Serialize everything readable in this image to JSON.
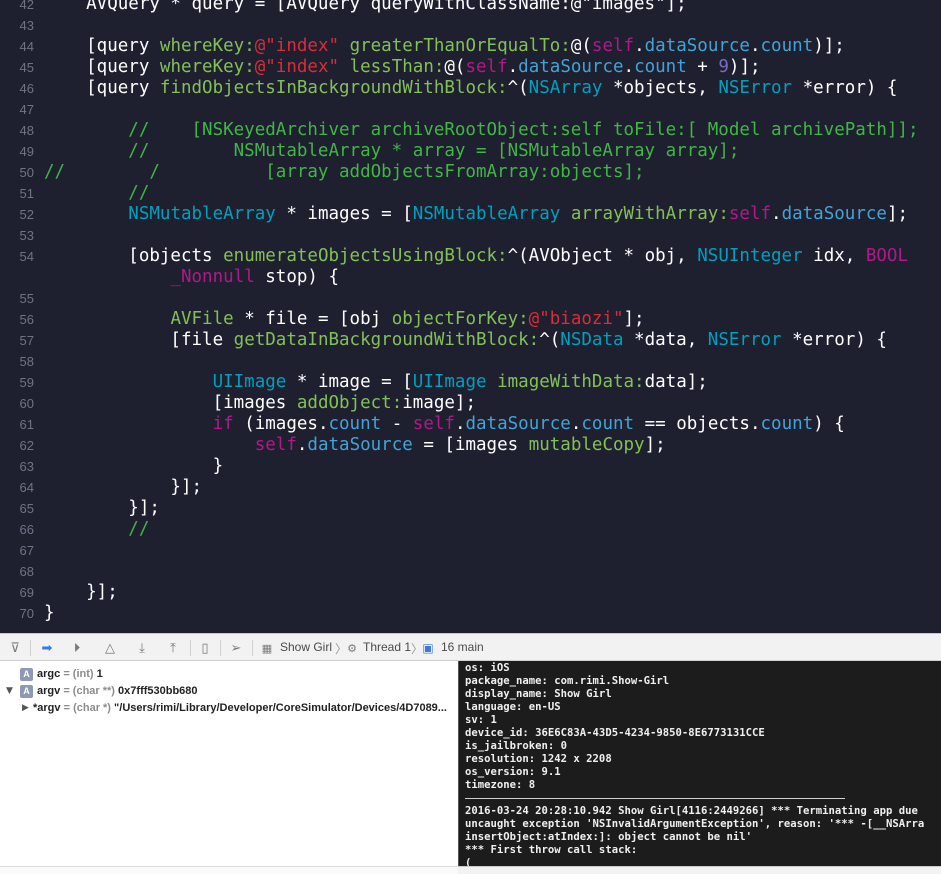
{
  "editor": {
    "lines": [
      {
        "n": "42",
        "tokens": [
          {
            "t": "    AVQuery * query = [AVQuery queryWithClassName:@\"images\"];",
            "c": "c-plain"
          }
        ]
      },
      {
        "n": "43",
        "tokens": []
      },
      {
        "n": "44",
        "tokens": [
          {
            "t": "    [query ",
            "c": "c-plain"
          },
          {
            "t": "whereKey:",
            "c": "c-method"
          },
          {
            "t": "@\"index\"",
            "c": "c-string"
          },
          {
            "t": " greaterThanOrEqualTo:",
            "c": "c-method"
          },
          {
            "t": "@(",
            "c": "c-plain"
          },
          {
            "t": "self",
            "c": "c-kw"
          },
          {
            "t": ".",
            "c": "c-plain"
          },
          {
            "t": "dataSource",
            "c": "c-prop"
          },
          {
            "t": ".",
            "c": "c-plain"
          },
          {
            "t": "count",
            "c": "c-prop"
          },
          {
            "t": ")];",
            "c": "c-plain"
          }
        ]
      },
      {
        "n": "45",
        "tokens": [
          {
            "t": "    [query ",
            "c": "c-plain"
          },
          {
            "t": "whereKey:",
            "c": "c-method"
          },
          {
            "t": "@\"index\"",
            "c": "c-string"
          },
          {
            "t": " lessThan:",
            "c": "c-method"
          },
          {
            "t": "@(",
            "c": "c-plain"
          },
          {
            "t": "self",
            "c": "c-kw"
          },
          {
            "t": ".",
            "c": "c-plain"
          },
          {
            "t": "dataSource",
            "c": "c-prop"
          },
          {
            "t": ".",
            "c": "c-plain"
          },
          {
            "t": "count",
            "c": "c-prop"
          },
          {
            "t": " + ",
            "c": "c-plain"
          },
          {
            "t": "9",
            "c": "c-num"
          },
          {
            "t": ")];",
            "c": "c-plain"
          }
        ]
      },
      {
        "n": "46",
        "tokens": [
          {
            "t": "    [query ",
            "c": "c-plain"
          },
          {
            "t": "findObjectsInBackgroundWithBlock:",
            "c": "c-method"
          },
          {
            "t": "^(",
            "c": "c-plain"
          },
          {
            "t": "NSArray",
            "c": "c-type"
          },
          {
            "t": " *objects, ",
            "c": "c-plain"
          },
          {
            "t": "NSError",
            "c": "c-type"
          },
          {
            "t": " *error) {",
            "c": "c-plain"
          }
        ]
      },
      {
        "n": "47",
        "tokens": []
      },
      {
        "n": "48",
        "tokens": [
          {
            "t": "        //    [NSKeyedArchiver archiveRootObject:self toFile:[ Model archivePath]];",
            "c": "c-comment"
          }
        ]
      },
      {
        "n": "49",
        "tokens": [
          {
            "t": "        //        NSMutableArray * array = [NSMutableArray array];",
            "c": "c-comment"
          }
        ]
      },
      {
        "n": "50",
        "tokens": [
          {
            "t": "//        /          [array addObjectsFromArray:objects];",
            "c": "c-comment"
          }
        ]
      },
      {
        "n": "51",
        "tokens": [
          {
            "t": "        //",
            "c": "c-comment"
          }
        ]
      },
      {
        "n": "52",
        "tokens": [
          {
            "t": "        ",
            "c": "c-plain"
          },
          {
            "t": "NSMutableArray",
            "c": "c-type"
          },
          {
            "t": " * images = [",
            "c": "c-plain"
          },
          {
            "t": "NSMutableArray",
            "c": "c-type"
          },
          {
            "t": " arrayWithArray:",
            "c": "c-method"
          },
          {
            "t": "self",
            "c": "c-kw"
          },
          {
            "t": ".",
            "c": "c-plain"
          },
          {
            "t": "dataSource",
            "c": "c-prop"
          },
          {
            "t": "];",
            "c": "c-plain"
          }
        ]
      },
      {
        "n": "53",
        "tokens": []
      },
      {
        "n": "54",
        "tokens": [
          {
            "t": "        [objects ",
            "c": "c-plain"
          },
          {
            "t": "enumerateObjectsUsingBlock:",
            "c": "c-method"
          },
          {
            "t": "^(AVObject * obj, ",
            "c": "c-plain"
          },
          {
            "t": "NSUInteger",
            "c": "c-type"
          },
          {
            "t": " idx, ",
            "c": "c-plain"
          },
          {
            "t": "BOOL",
            "c": "c-kw"
          }
        ]
      },
      {
        "n": "",
        "tokens": [
          {
            "t": "            ",
            "c": "c-plain"
          },
          {
            "t": "_Nonnull",
            "c": "c-kw"
          },
          {
            "t": " stop) {",
            "c": "c-plain"
          }
        ]
      },
      {
        "n": "55",
        "tokens": []
      },
      {
        "n": "56",
        "tokens": [
          {
            "t": "            ",
            "c": "c-plain"
          },
          {
            "t": "AVFile",
            "c": "c-method"
          },
          {
            "t": " * file = [obj ",
            "c": "c-plain"
          },
          {
            "t": "objectForKey:",
            "c": "c-method"
          },
          {
            "t": "@\"biaozi\"",
            "c": "c-string"
          },
          {
            "t": "];",
            "c": "c-plain"
          }
        ]
      },
      {
        "n": "57",
        "tokens": [
          {
            "t": "            [file ",
            "c": "c-plain"
          },
          {
            "t": "getDataInBackgroundWithBlock:",
            "c": "c-method"
          },
          {
            "t": "^(",
            "c": "c-plain"
          },
          {
            "t": "NSData",
            "c": "c-type"
          },
          {
            "t": " *data, ",
            "c": "c-plain"
          },
          {
            "t": "NSError",
            "c": "c-type"
          },
          {
            "t": " *error) {",
            "c": "c-plain"
          }
        ]
      },
      {
        "n": "58",
        "tokens": []
      },
      {
        "n": "59",
        "tokens": [
          {
            "t": "                ",
            "c": "c-plain"
          },
          {
            "t": "UIImage",
            "c": "c-type"
          },
          {
            "t": " * image = [",
            "c": "c-plain"
          },
          {
            "t": "UIImage",
            "c": "c-type"
          },
          {
            "t": " imageWithData:",
            "c": "c-method"
          },
          {
            "t": "data];",
            "c": "c-plain"
          }
        ]
      },
      {
        "n": "60",
        "tokens": [
          {
            "t": "                [images ",
            "c": "c-plain"
          },
          {
            "t": "addObject:",
            "c": "c-method"
          },
          {
            "t": "image];",
            "c": "c-plain"
          }
        ]
      },
      {
        "n": "61",
        "tokens": [
          {
            "t": "                ",
            "c": "c-plain"
          },
          {
            "t": "if",
            "c": "c-kw"
          },
          {
            "t": " (images.",
            "c": "c-plain"
          },
          {
            "t": "count",
            "c": "c-prop"
          },
          {
            "t": " - ",
            "c": "c-plain"
          },
          {
            "t": "self",
            "c": "c-kw"
          },
          {
            "t": ".",
            "c": "c-plain"
          },
          {
            "t": "dataSource",
            "c": "c-prop"
          },
          {
            "t": ".",
            "c": "c-plain"
          },
          {
            "t": "count",
            "c": "c-prop"
          },
          {
            "t": " == objects.",
            "c": "c-plain"
          },
          {
            "t": "count",
            "c": "c-prop"
          },
          {
            "t": ") {",
            "c": "c-plain"
          }
        ]
      },
      {
        "n": "62",
        "tokens": [
          {
            "t": "                    ",
            "c": "c-plain"
          },
          {
            "t": "self",
            "c": "c-kw"
          },
          {
            "t": ".",
            "c": "c-plain"
          },
          {
            "t": "dataSource",
            "c": "c-prop"
          },
          {
            "t": " = [images ",
            "c": "c-plain"
          },
          {
            "t": "mutableCopy",
            "c": "c-method"
          },
          {
            "t": "];",
            "c": "c-plain"
          }
        ]
      },
      {
        "n": "63",
        "tokens": [
          {
            "t": "                }",
            "c": "c-plain"
          }
        ]
      },
      {
        "n": "64",
        "tokens": [
          {
            "t": "            }];",
            "c": "c-plain"
          }
        ]
      },
      {
        "n": "65",
        "tokens": [
          {
            "t": "        }];",
            "c": "c-plain"
          }
        ]
      },
      {
        "n": "66",
        "tokens": [
          {
            "t": "        //",
            "c": "c-comment"
          }
        ]
      },
      {
        "n": "67",
        "tokens": []
      },
      {
        "n": "68",
        "tokens": []
      },
      {
        "n": "69",
        "tokens": [
          {
            "t": "    }];",
            "c": "c-plain"
          }
        ]
      },
      {
        "n": "70",
        "tokens": [
          {
            "t": "}",
            "c": "c-plain"
          }
        ]
      }
    ]
  },
  "debug_bar": {
    "breadcrumb": {
      "target": "Show Girl",
      "thread": "Thread 1",
      "frame": "16 main"
    }
  },
  "variables": [
    {
      "badge": "A",
      "name": "argc",
      "type": "= (int)",
      "value": "1",
      "disclosure": ""
    },
    {
      "badge": "A",
      "name": "argv",
      "type": "= (char **)",
      "value": "0x7fff530bb680",
      "disclosure": "▼"
    },
    {
      "badge": "",
      "name": "*argv",
      "type": "= (char *)",
      "value": "\"/Users/rimi/Library/Developer/CoreSimulator/Devices/4D7089...",
      "disclosure": "▶"
    }
  ],
  "console": {
    "lines": [
      "os: iOS",
      "package_name: com.rimi.Show-Girl",
      "display_name: Show Girl",
      "language: en-US",
      "sv: 1",
      "device_id: 36E6C83A-43D5-4234-9850-8E6773131CCE",
      "is_jailbroken: 0",
      "resolution: 1242 x 2208",
      "os_version: 9.1",
      "timezone: 8",
      "",
      "2016-03-24 20:28:10.942 Show Girl[4116:2449266] *** Terminating app due",
      "uncaught exception 'NSInvalidArgumentException', reason: '*** -[__NSArra",
      "insertObject:atIndex:]: object cannot be nil'",
      "*** First throw call stack:",
      "("
    ]
  }
}
